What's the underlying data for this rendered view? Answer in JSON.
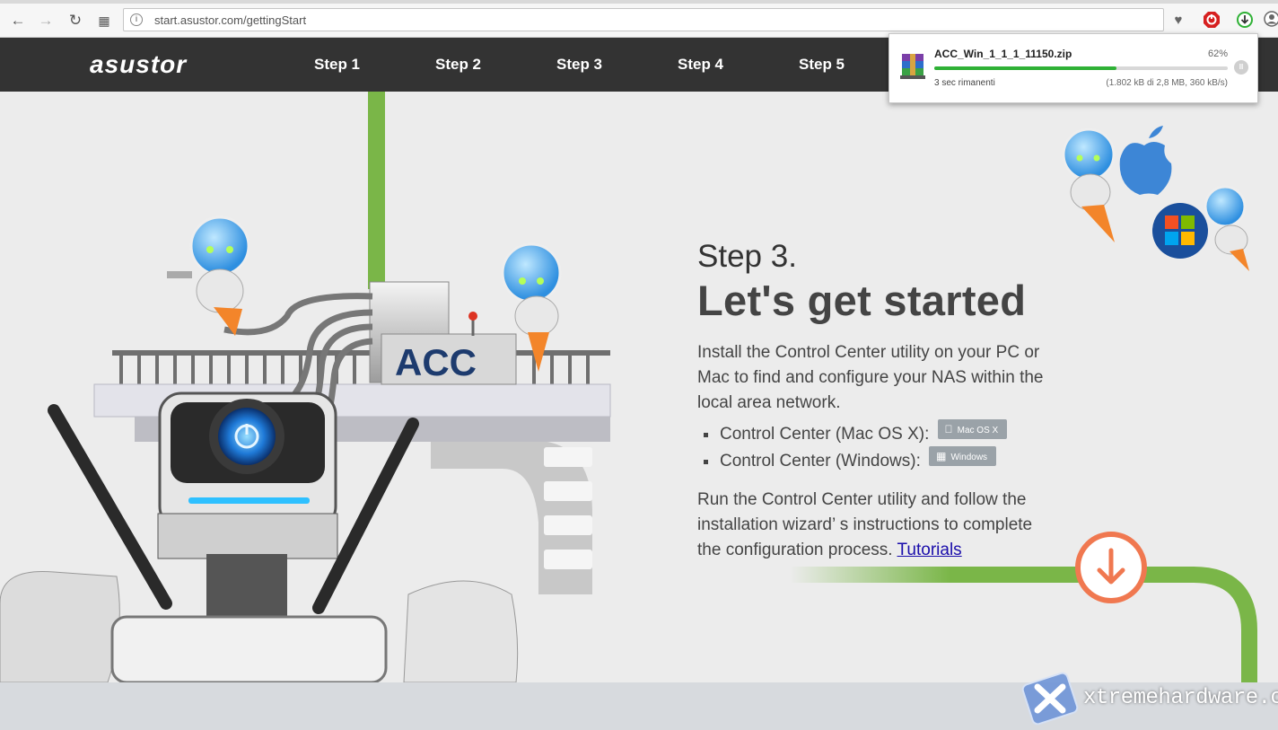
{
  "browser": {
    "url": "start.asustor.com/gettingStart"
  },
  "site": {
    "logo": "asustor",
    "nav": [
      "Step 1",
      "Step 2",
      "Step 3",
      "Step 4",
      "Step 5"
    ]
  },
  "content": {
    "step_label": "Step 3.",
    "title": "Let's get started",
    "intro": "Install the Control Center utility on your PC or Mac to find and configure your NAS within the local area network.",
    "downloads": [
      {
        "label": "Control Center (Mac OS X):",
        "button": "Mac OS X",
        "icon": "apple-icon"
      },
      {
        "label": "Control Center (Windows):",
        "button": "Windows",
        "icon": "windows-icon"
      }
    ],
    "outro": "Run the Control Center utility and follow the installation wizard’ s instructions to complete the configuration process.",
    "tutorials_link": "Tutorials",
    "illustration_text": "ACC"
  },
  "download": {
    "filename": "ACC_Win_1_1_1_11150.zip",
    "percent_label": "62%",
    "progress": 0.62,
    "status": "3 sec rimanenti",
    "detail": "(1.802 kB di 2,8 MB, 360 kB/s)"
  },
  "watermark": "xtremehardware.com",
  "colors": {
    "header_bg": "#333333",
    "accent_green": "#7ab648",
    "accent_orange": "#f07850",
    "progress_green": "#2fb136"
  }
}
